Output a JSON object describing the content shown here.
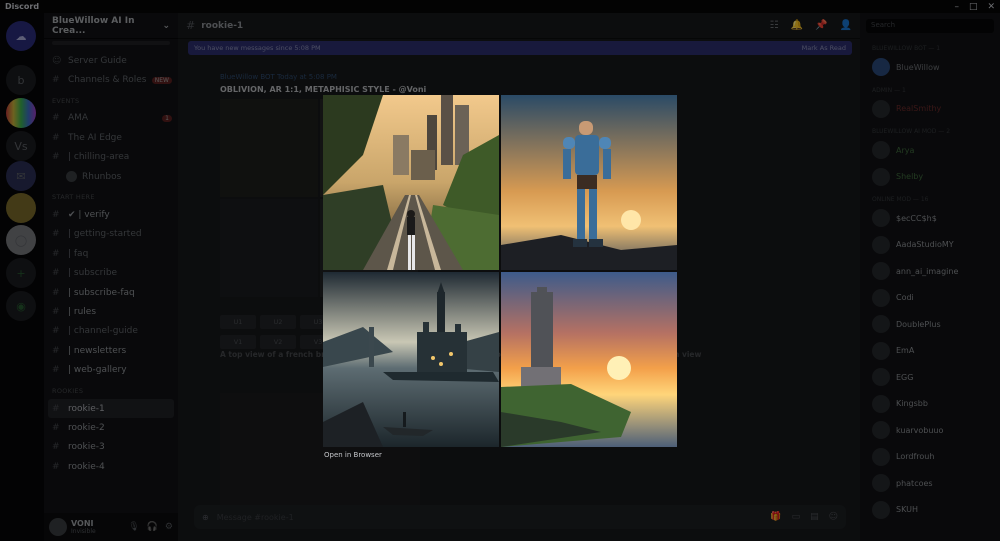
{
  "window": {
    "app_name": "Discord",
    "controls": [
      "–",
      "□",
      "✕"
    ]
  },
  "server": {
    "name": "BlueWillow AI In Crea...",
    "guild_icons": [
      "discord-logo",
      "b",
      "colorful-server",
      "Vs",
      "willow-server",
      "ai-server",
      "circle-server",
      "add-server",
      "explore-server"
    ],
    "channels_top": [
      {
        "icon": "☺",
        "label": "Server Guide"
      },
      {
        "icon": "#",
        "label": "Channels & Roles",
        "badge": "NEW"
      }
    ],
    "category_events": "EVENTS",
    "channels_events": [
      {
        "icon": "#",
        "label": "AMA",
        "badge": "1"
      },
      {
        "icon": "#",
        "label": "The AI Edge"
      },
      {
        "icon": "#",
        "label": "| chilling-area"
      }
    ],
    "thread_user": "Rhunbos",
    "category_start": "START HERE",
    "channels_start": [
      {
        "icon": "#",
        "label": "✔ | verify",
        "bold": true
      },
      {
        "icon": "#",
        "label": "| getting-started"
      },
      {
        "icon": "#",
        "label": "| faq"
      },
      {
        "icon": "#",
        "label": "| subscribe"
      },
      {
        "icon": "#",
        "label": "| subscribe-faq",
        "bold": true
      },
      {
        "icon": "#",
        "label": "| rules",
        "bold": true
      },
      {
        "icon": "#",
        "label": "| channel-guide"
      },
      {
        "icon": "#",
        "label": "| newsletters",
        "bold": true
      },
      {
        "icon": "#",
        "label": "| web-gallery",
        "bold": true
      }
    ],
    "category_rookies": "ROOKIES",
    "channels_rookies": [
      {
        "icon": "#",
        "label": "rookie-1",
        "selected": true
      },
      {
        "icon": "#",
        "label": "rookie-2",
        "bold": true
      },
      {
        "icon": "#",
        "label": "rookie-3",
        "bold": true
      },
      {
        "icon": "#",
        "label": "rookie-4",
        "bold": true
      }
    ]
  },
  "user": {
    "name": "VONI",
    "status": "Invisible"
  },
  "chat": {
    "channel": "rookie-1",
    "new_messages_banner": "You have new messages since 5:08 PM",
    "mark_as_read": "Mark As Read",
    "sender": "BlueWillow  BOT  Today at 5:08 PM",
    "message_title": "OBLIVION, AR 1:1, METAPHISIC STYLE - @Voni",
    "variant_buttons": [
      "U1",
      "U2",
      "U3",
      "U4",
      "V1",
      "V2",
      "V3",
      "V4"
    ],
    "prompt_text": "A top view of a french breakfast with croissants, a smoking hot coffee and a orange juice in a glass, wooden view",
    "composer_placeholder": "Message #rookie-1"
  },
  "members": {
    "search_placeholder": "Search",
    "categories": [
      {
        "label": "BLUEWILLOW BOT — 1",
        "members": [
          "BlueWillow"
        ]
      },
      {
        "label": "ADMIN — 1",
        "members": [
          "RealSmithy"
        ]
      },
      {
        "label": "BLUEWILLOW AI MOD — 2",
        "members": [
          "Arya",
          "Shelby"
        ]
      },
      {
        "label": "ONLINE MOD — 16",
        "members": [
          "$ecCC$h$",
          "AadaStudioMY",
          "ann_ai_imagine",
          "Codi",
          "DoublePlus",
          "EmA",
          "EGG",
          "Kingsbb",
          "kuarvobuuo",
          "Lordfrouh",
          "phatcoes",
          "SKUH"
        ]
      }
    ]
  },
  "viewer": {
    "open_in_browser": "Open in Browser",
    "tiles": [
      "railway-city-image",
      "armored-warrior-image",
      "dark-castle-lake-image",
      "sunset-tower-image"
    ]
  },
  "colors": {
    "accent": "#5865f2",
    "banner": "#2c2f6e",
    "online": "#3ba55c"
  }
}
